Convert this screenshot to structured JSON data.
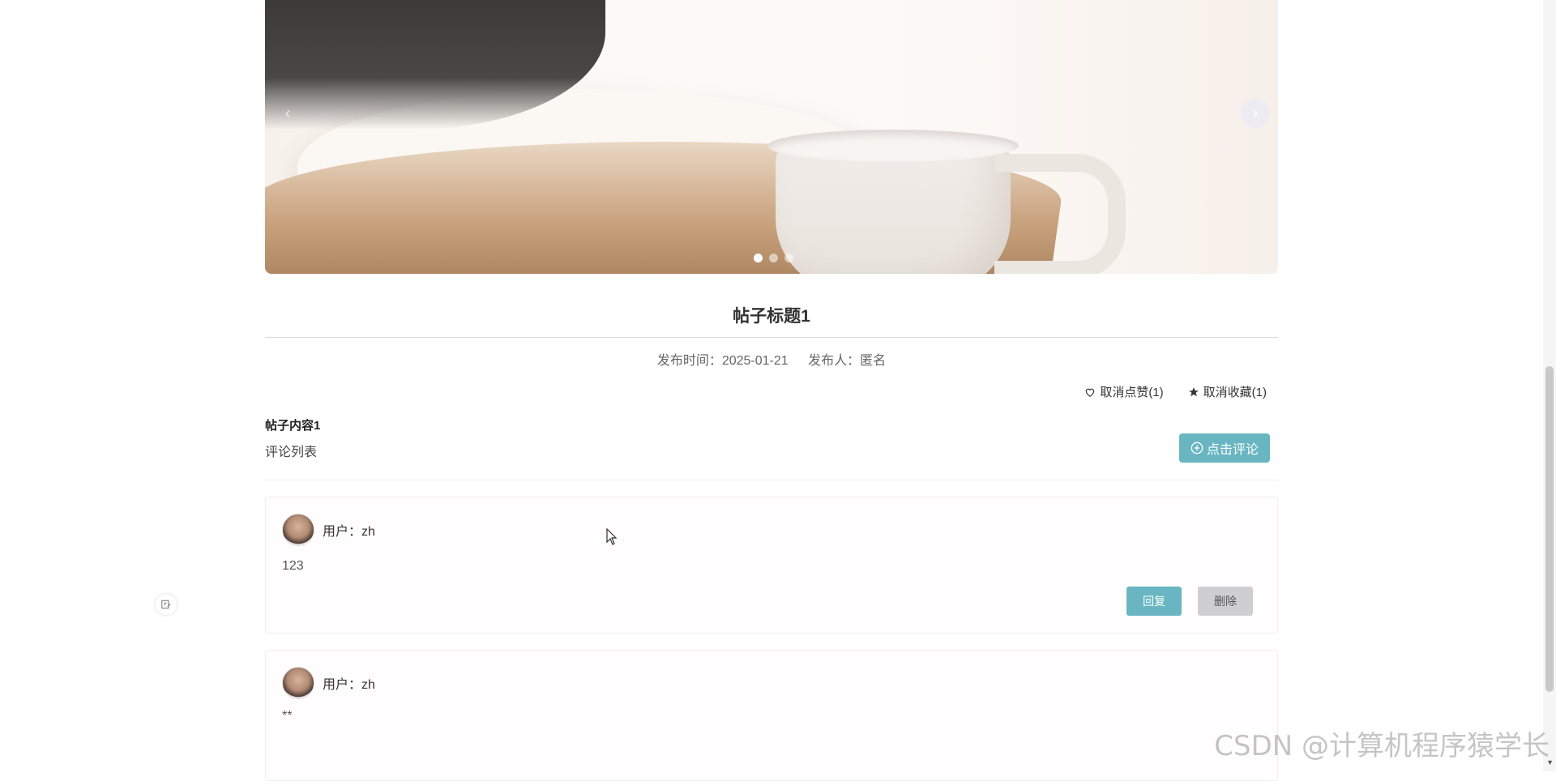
{
  "post": {
    "title": "帖子标题1",
    "publish_time": "发布时间：2025-01-21",
    "publisher": "发布人：匿名",
    "content": "帖子内容1"
  },
  "actions": {
    "like_label": "取消点赞(1)",
    "favorite_label": "取消收藏(1)"
  },
  "comments_section": {
    "heading": "评论列表",
    "add_button": "点击评论"
  },
  "comments": [
    {
      "user": "用户：zh",
      "text": "123",
      "reply_label": "回复",
      "delete_label": "删除"
    },
    {
      "user": "用户：zh",
      "text": "**"
    }
  ],
  "carousel": {
    "slides": 3,
    "active": 0
  },
  "watermark": "CSDN @计算机程序猿学长",
  "colors": {
    "accent": "#69b6c2",
    "delete_bg": "#cfcfd3"
  }
}
